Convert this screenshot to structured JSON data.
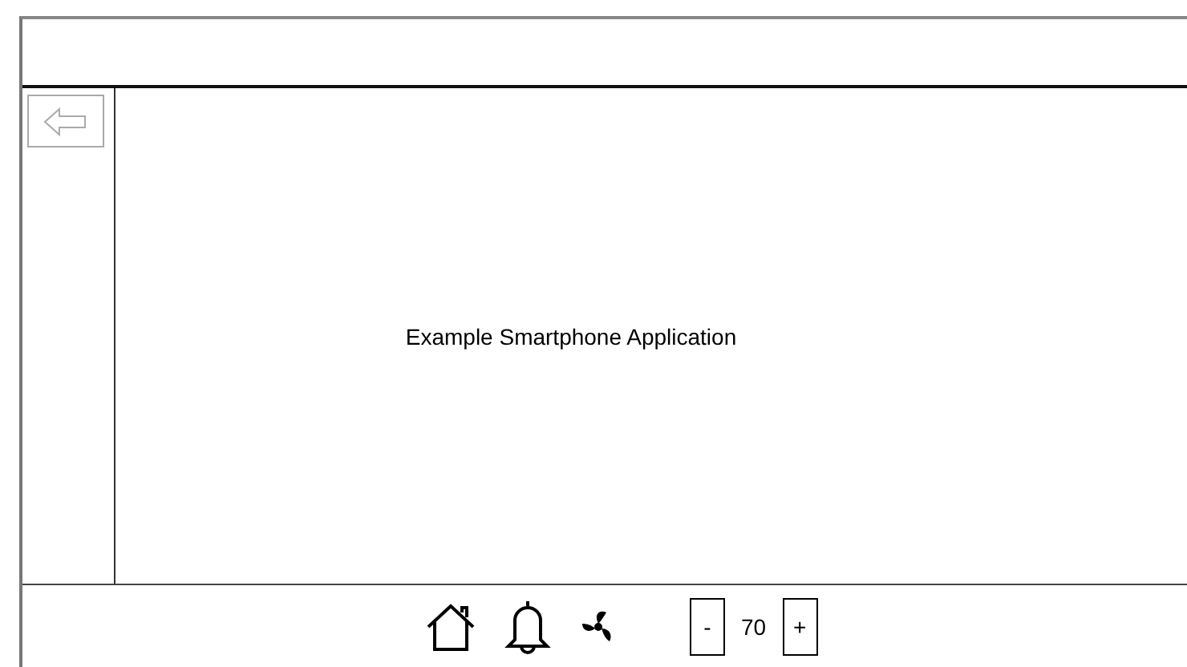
{
  "content": {
    "text": "Example Smartphone Application"
  },
  "footer": {
    "decrease": "-",
    "value": "70",
    "increase": "+"
  }
}
